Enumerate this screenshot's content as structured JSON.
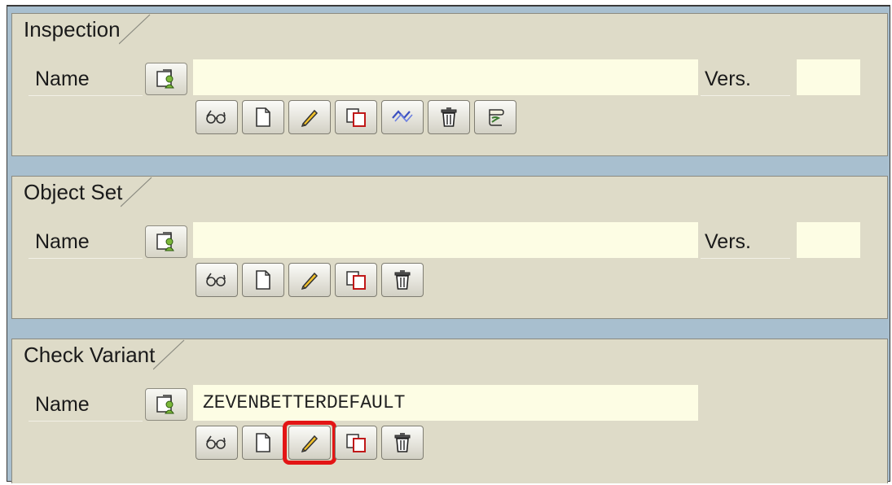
{
  "groups": [
    {
      "id": "inspection",
      "title": "Inspection",
      "name_label": "Name",
      "name_value": "",
      "vers_label": "Vers.",
      "vers_value": "",
      "toolbar": [
        "display-icon",
        "create-icon",
        "change-icon",
        "copy-icon",
        "rename-icon",
        "delete-icon",
        "execute-icon"
      ]
    },
    {
      "id": "object-set",
      "title": "Object Set",
      "name_label": "Name",
      "name_value": "",
      "vers_label": "Vers.",
      "vers_value": "",
      "toolbar": [
        "display-icon",
        "create-icon",
        "change-icon",
        "copy-icon",
        "delete-icon"
      ]
    },
    {
      "id": "check-variant",
      "title": "Check Variant",
      "name_label": "Name",
      "name_value": "ZEVENBETTERDEFAULT",
      "toolbar": [
        "display-icon",
        "create-icon",
        "change-icon",
        "copy-icon",
        "delete-icon"
      ],
      "highlighted_button": "change-icon"
    }
  ],
  "colors": {
    "background": "#a8bfcf",
    "group": "#dedbc8",
    "input": "#fdfde4",
    "highlight": "#e31515"
  }
}
